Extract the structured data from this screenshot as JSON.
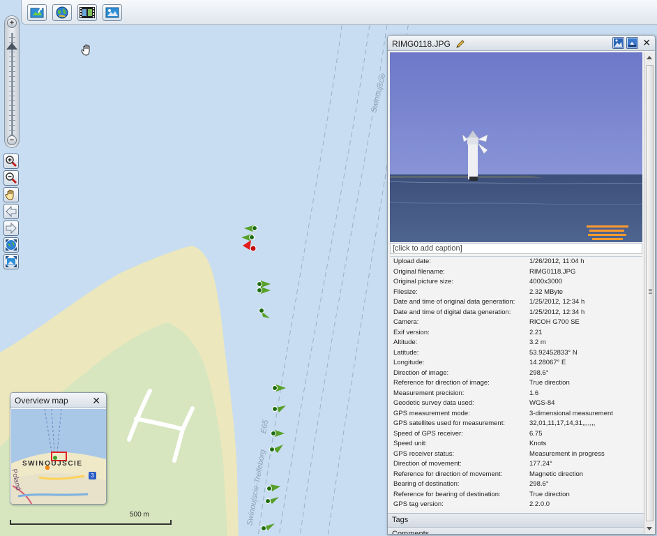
{
  "map": {
    "route_label_1": "Swinoujscie",
    "route_label_2": "Swinoujscie-Trelleborg",
    "route_label_3": "E65"
  },
  "toolbar": {
    "buttons": [
      "upload-icon",
      "globe-icon",
      "filmstrip-icon",
      "photo-icon"
    ]
  },
  "zoom_slider": {
    "plus": "+",
    "minus": "−"
  },
  "overview": {
    "title": "Overview map",
    "close": "✕",
    "town": "SWINOUJSCIE",
    "country": "Poland",
    "road_number": "3"
  },
  "scale": {
    "label": "500 m"
  },
  "panel": {
    "title": "RIMG0118.JPG",
    "close": "✕",
    "caption_placeholder": "[click to add caption]",
    "exif": [
      {
        "label": "Upload date:",
        "value": "1/26/2012, 11:04 h"
      },
      {
        "label": "Original filename:",
        "value": "RIMG0118.JPG"
      },
      {
        "label": "Original picture size:",
        "value": "4000x3000"
      },
      {
        "label": "Filesize:",
        "value": "2.32 MByte"
      },
      {
        "label": "Date and time of original data generation:",
        "value": "1/25/2012, 12:34 h"
      },
      {
        "label": "Date and time of digital data generation:",
        "value": "1/25/2012, 12:34 h"
      },
      {
        "label": "Camera:",
        "value": "RICOH G700 SE"
      },
      {
        "label": "Exif version:",
        "value": "2.21"
      },
      {
        "label": "Altitude:",
        "value": "3.2 m"
      },
      {
        "label": "Latitude:",
        "value": "53.92452833° N"
      },
      {
        "label": "Longitude:",
        "value": "14.28067° E"
      },
      {
        "label": "Direction of image:",
        "value": "298.6°"
      },
      {
        "label": "Reference for direction of image:",
        "value": "True direction"
      },
      {
        "label": "Measurement precision:",
        "value": "1.6"
      },
      {
        "label": "Geodetic survey data used:",
        "value": "WGS-84"
      },
      {
        "label": "GPS measurement mode:",
        "value": "3-dimensional measurement"
      },
      {
        "label": "GPS satellites used for measurement:",
        "value": "32,01,11,17,14,31,,,,,,,"
      },
      {
        "label": "Speed of GPS receiver:",
        "value": "6.75"
      },
      {
        "label": "Speed unit:",
        "value": "Knots"
      },
      {
        "label": "GPS receiver status:",
        "value": "Measurement in progress"
      },
      {
        "label": "Direction of movement:",
        "value": "177.24°"
      },
      {
        "label": "Reference for direction of movement:",
        "value": "Magnetic direction"
      },
      {
        "label": "Bearing of destination:",
        "value": "298.6°"
      },
      {
        "label": "Reference for bearing of destination:",
        "value": "True direction"
      },
      {
        "label": "GPS tag version:",
        "value": "2.2.0.0"
      }
    ],
    "tags_label": "Tags",
    "comments_label": "Comments"
  }
}
